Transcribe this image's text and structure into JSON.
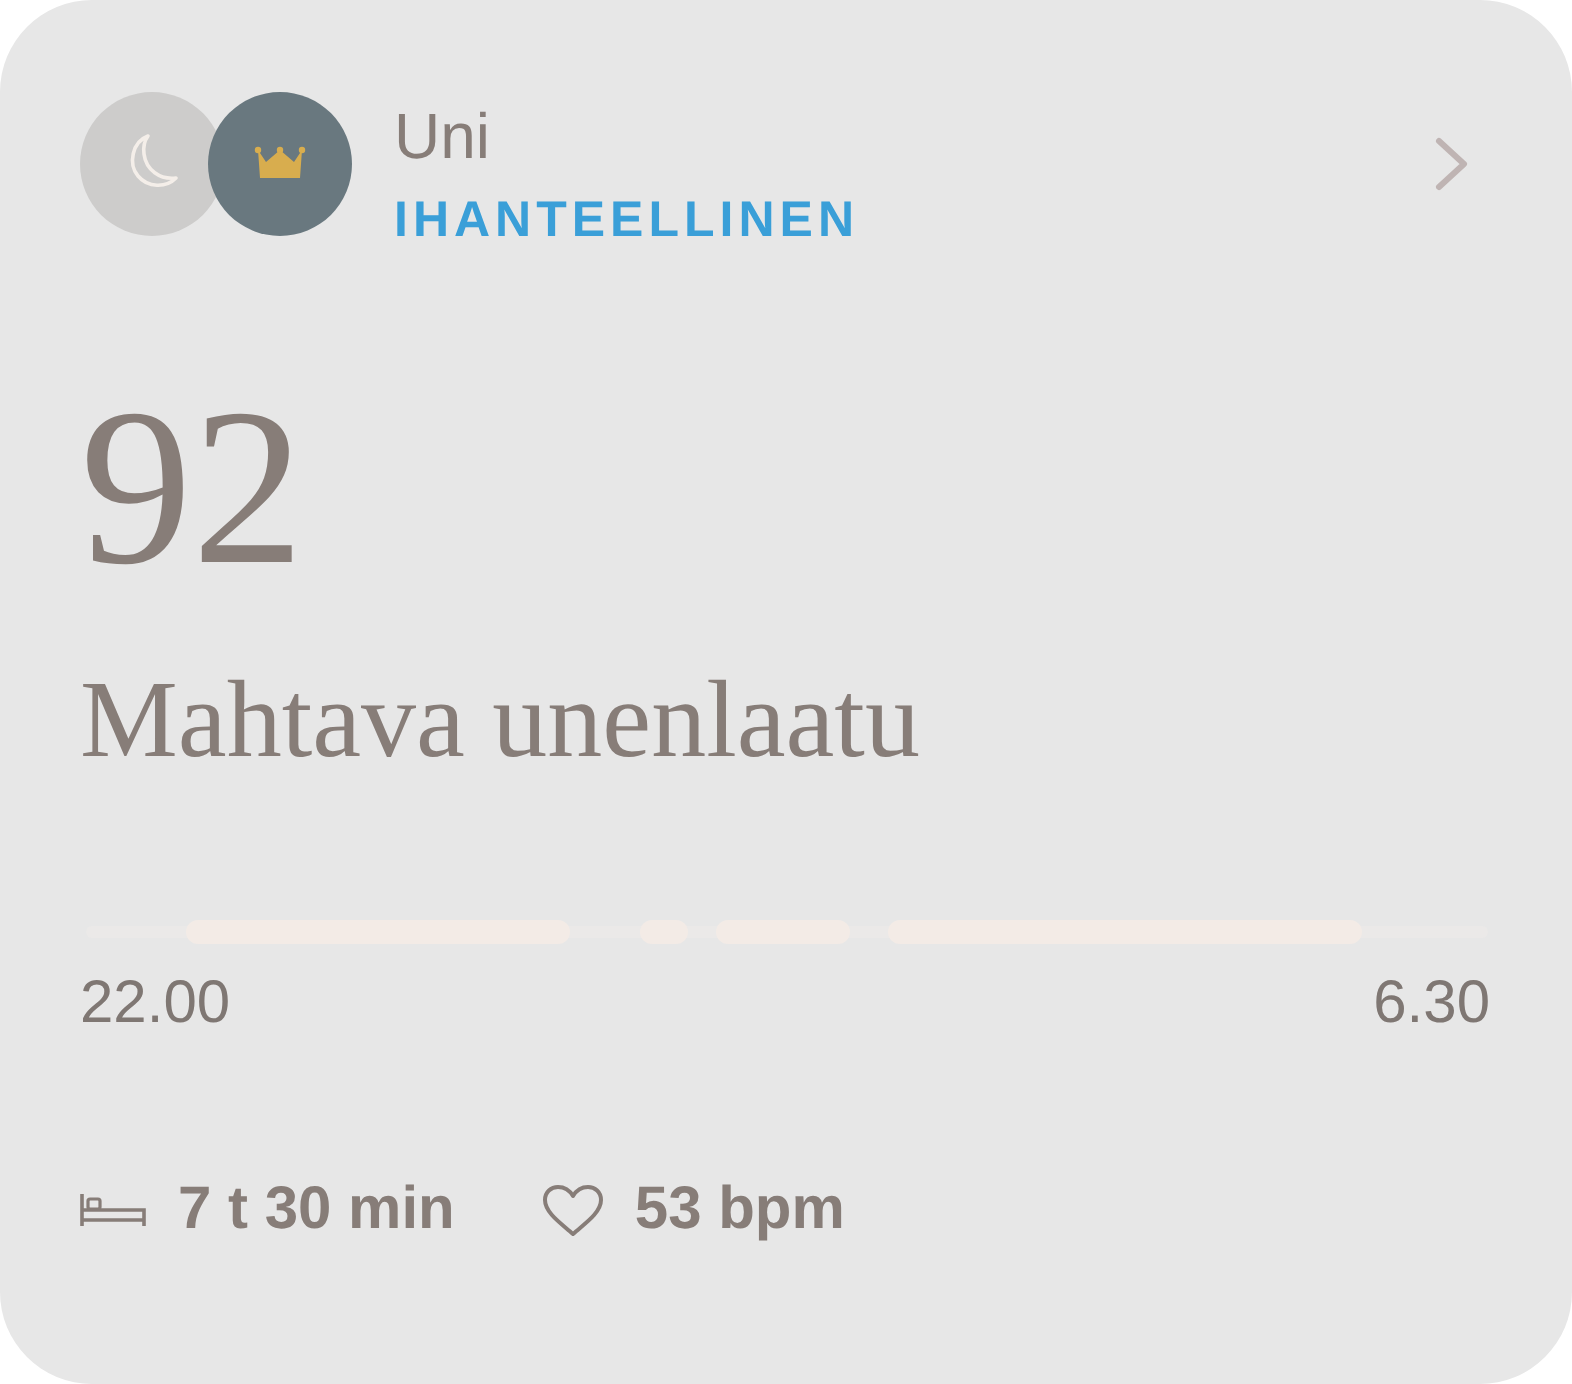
{
  "card": {
    "title": "Uni",
    "status": "IHANTEELLINEN"
  },
  "score": "92",
  "summary": "Mahtava unenlaatu",
  "timeline": {
    "start": "22.00",
    "end": "6.30"
  },
  "stats": [
    {
      "kind": "duration",
      "value": "7 t 30 min"
    },
    {
      "kind": "heart_rate",
      "value": "53 bpm"
    }
  ]
}
